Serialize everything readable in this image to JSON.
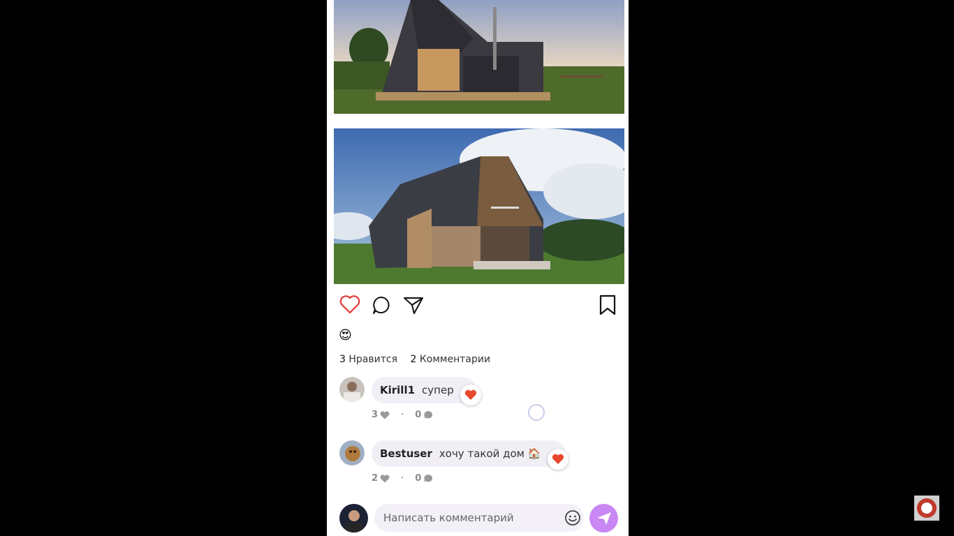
{
  "post": {
    "reaction_emoji": "😍",
    "likes": {
      "count": "3",
      "label": "Нравится"
    },
    "comments_count": {
      "count": "2",
      "label": "Комментарии"
    }
  },
  "comments": [
    {
      "user": "Kirill1",
      "text": "супер",
      "likes": "3",
      "replies": "0"
    },
    {
      "user": "Bestuser",
      "text": "хочу такой дом 🏠",
      "likes": "2",
      "replies": "0"
    }
  ],
  "composer": {
    "placeholder": "Написать комментарий"
  },
  "colors": {
    "like_red": "#e53935",
    "send_purple": "#c887f2",
    "bubble_bg": "#f1eff5"
  }
}
